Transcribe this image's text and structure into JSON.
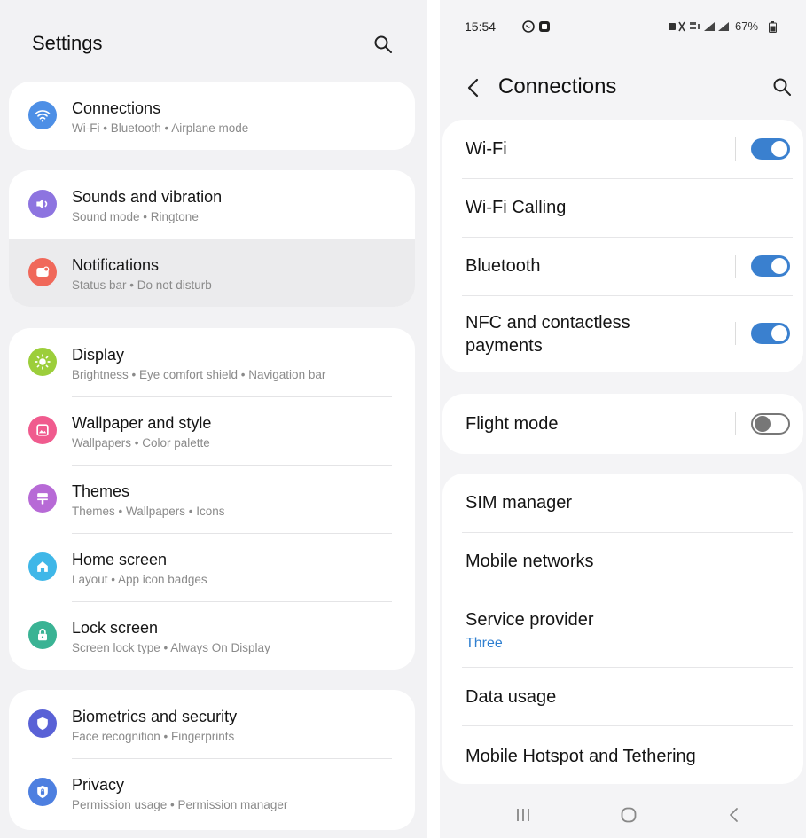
{
  "left": {
    "title": "Settings",
    "groups": [
      {
        "items": [
          {
            "title": "Connections",
            "subtitle": "Wi-Fi  •  Bluetooth  •  Airplane mode",
            "icon": "wifi-icon",
            "color": "#4d8fe6"
          }
        ]
      },
      {
        "items": [
          {
            "title": "Sounds and vibration",
            "subtitle": "Sound mode  •  Ringtone",
            "icon": "volume-icon",
            "color": "#8d74e0"
          },
          {
            "title": "Notifications",
            "subtitle": "Status bar  •  Do not disturb",
            "icon": "notification-icon",
            "color": "#f0685a"
          }
        ]
      },
      {
        "items": [
          {
            "title": "Display",
            "subtitle": "Brightness  •  Eye comfort shield  •  Navigation bar",
            "icon": "brightness-icon",
            "color": "#9cce3b"
          },
          {
            "title": "Wallpaper and style",
            "subtitle": "Wallpapers  •  Color palette",
            "icon": "wallpaper-icon",
            "color": "#f05b8e"
          },
          {
            "title": "Themes",
            "subtitle": "Themes  •  Wallpapers  •  Icons",
            "icon": "themes-icon",
            "color": "#b76ad6"
          },
          {
            "title": "Home screen",
            "subtitle": "Layout  •  App icon badges",
            "icon": "home-icon",
            "color": "#3fb7e8"
          },
          {
            "title": "Lock screen",
            "subtitle": "Screen lock type  •  Always On Display",
            "icon": "lock-icon",
            "color": "#3ab394"
          }
        ]
      },
      {
        "items": [
          {
            "title": "Biometrics and security",
            "subtitle": "Face recognition  •  Fingerprints",
            "icon": "shield-icon",
            "color": "#5961d6"
          },
          {
            "title": "Privacy",
            "subtitle": "Permission usage  •  Permission manager",
            "icon": "privacy-icon",
            "color": "#4d7fe0"
          }
        ]
      }
    ]
  },
  "right": {
    "status": {
      "time": "15:54",
      "battery": "67%"
    },
    "title": "Connections",
    "accent": "#3a80cf",
    "groups": [
      {
        "items": [
          {
            "title": "Wi-Fi",
            "toggle": true
          },
          {
            "title": "Wi-Fi Calling"
          },
          {
            "title": "Bluetooth",
            "toggle": true
          },
          {
            "title": "NFC and contactless",
            "title2": "payments",
            "toggle": true
          }
        ]
      },
      {
        "items": [
          {
            "title": "Flight mode",
            "toggle": false
          }
        ]
      },
      {
        "items": [
          {
            "title": "SIM manager"
          },
          {
            "title": "Mobile networks"
          },
          {
            "title": "Service provider",
            "subtitle": "Three"
          },
          {
            "title": "Data usage"
          },
          {
            "title": "Mobile Hotspot and Tethering"
          }
        ]
      }
    ],
    "nav": [
      "recents-icon",
      "home-icon",
      "back-icon"
    ]
  }
}
